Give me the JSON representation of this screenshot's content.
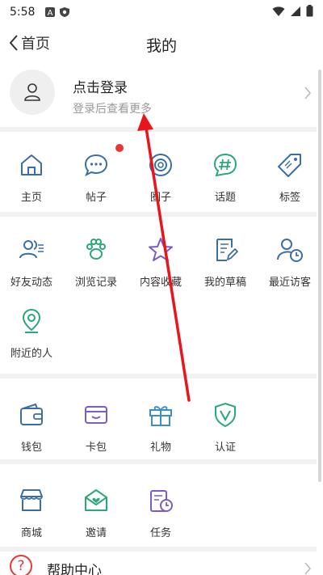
{
  "status_bar": {
    "time": "5:58"
  },
  "nav": {
    "back_label": "首页",
    "title": "我的"
  },
  "login": {
    "title": "点击登录",
    "subtitle": "登录后查看更多"
  },
  "section1": [
    {
      "label": "主页",
      "icon": "home-icon"
    },
    {
      "label": "帖子",
      "icon": "chat-bubble-icon"
    },
    {
      "label": "圈子",
      "icon": "circle-icon"
    },
    {
      "label": "话题",
      "icon": "hashtag-icon"
    },
    {
      "label": "标签",
      "icon": "tag-icon"
    }
  ],
  "section2": [
    {
      "label": "好友动态",
      "icon": "friends-icon"
    },
    {
      "label": "浏览记录",
      "icon": "paw-icon"
    },
    {
      "label": "内容收藏",
      "icon": "star-icon"
    },
    {
      "label": "我的草稿",
      "icon": "draft-icon"
    },
    {
      "label": "最近访客",
      "icon": "visitor-clock-icon"
    },
    {
      "label": "附近的人",
      "icon": "location-pin-icon"
    }
  ],
  "section3": [
    {
      "label": "钱包",
      "icon": "wallet-icon"
    },
    {
      "label": "卡包",
      "icon": "card-icon"
    },
    {
      "label": "礼物",
      "icon": "gift-icon"
    },
    {
      "label": "认证",
      "icon": "shield-v-icon"
    }
  ],
  "section4": [
    {
      "label": "商城",
      "icon": "store-icon"
    },
    {
      "label": "邀请",
      "icon": "invite-mail-icon"
    },
    {
      "label": "任务",
      "icon": "task-icon"
    }
  ],
  "help": {
    "label": "帮助中心",
    "icon_glyph": "?"
  },
  "colors": {
    "blue": "#3a6ea5",
    "green": "#2aa876",
    "purple": "#7a5cc6",
    "red": "#e53935",
    "divider": "#f1f1f1"
  }
}
